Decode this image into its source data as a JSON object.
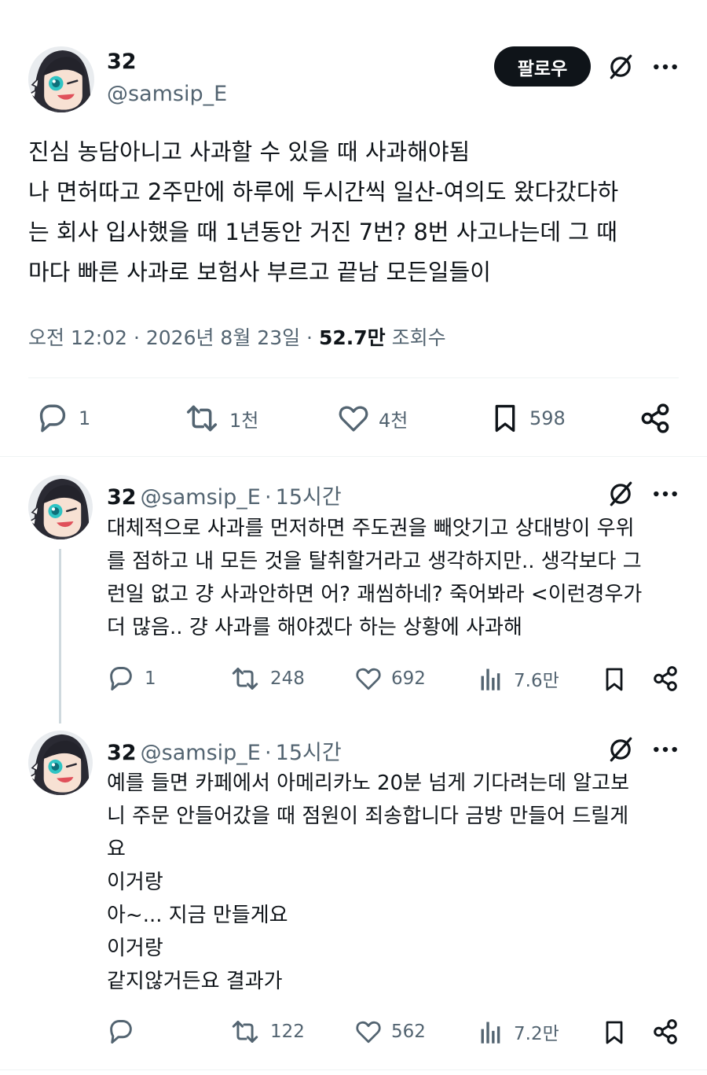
{
  "main_post": {
    "author_name": "32",
    "author_handle": "@samsip_E",
    "follow_label": "팔로우",
    "text": "진심 농담아니고 사과할 수 있을 때 사과해야됨\n나 면허따고 2주만에 하루에 두시간씩 일산-여의도 왔다갔다하\n는 회사 입사했을 때 1년동안 거진 7번? 8번 사고나는데 그 때\n마다 빠른 사과로 보험사 부르고 끝남 모든일들이",
    "time": "오전 12:02",
    "date": "2026년 8월 23일",
    "views": "52.7만",
    "views_label": "조회수",
    "sep": "·",
    "actions": {
      "replies": "1",
      "reposts": "1천",
      "likes": "4천",
      "bookmarks": "598"
    }
  },
  "replies": [
    {
      "author_name": "32",
      "author_handle": "@samsip_E",
      "time_ago": "15시간",
      "sep": "·",
      "text": "대체적으로 사과를 먼저하면 주도권을 빼앗기고 상대방이 우위\n를 점하고 내 모든 것을 탈취할거라고 생각하지만.. 생각보다 그\n런일 없고 걍 사과안하면 어? 괘씸하네? 죽어봐라 <이런경우가\n더 많음.. 걍 사과를 해야겠다 하는 상황에 사과해",
      "actions": {
        "replies": "1",
        "reposts": "248",
        "likes": "692",
        "views": "7.6만"
      }
    },
    {
      "author_name": "32",
      "author_handle": "@samsip_E",
      "time_ago": "15시간",
      "sep": "·",
      "text": "예를 들면 카페에서 아메리카노 20분 넘게 기다려는데 알고보\n니 주문 안들어갔을 때 점원이 죄송합니다 금방 만들어 드릴게\n요\n이거랑\n아~... 지금 만들게요\n이거랑\n같지않거든요 결과가",
      "actions": {
        "replies": "",
        "reposts": "122",
        "likes": "562",
        "views": "7.2만"
      }
    }
  ],
  "colors": {
    "text": "#0f1419",
    "muted": "#536471",
    "divider": "#eff3f4",
    "button": "#0f1419"
  }
}
